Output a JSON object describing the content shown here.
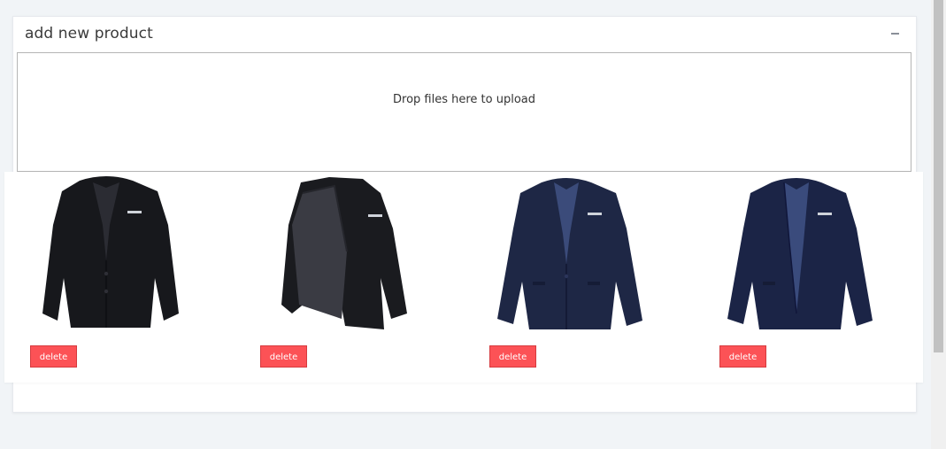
{
  "panel": {
    "title": "add new product",
    "collapse_icon": "minus-icon"
  },
  "dropzone": {
    "message": "Drop files here to upload"
  },
  "previews": [
    {
      "image": "black-blazer-front",
      "color": "#17181c",
      "delete_label": "delete"
    },
    {
      "image": "black-blazer-open",
      "color": "#1a1b1f",
      "delete_label": "delete"
    },
    {
      "image": "navy-blazer-front",
      "color": "#1e2745",
      "delete_label": "delete"
    },
    {
      "image": "navy-blazer-front",
      "color": "#1b2446",
      "delete_label": "delete"
    }
  ],
  "colors": {
    "delete_button": "#fc5256",
    "page_background": "#f1f4f7"
  }
}
